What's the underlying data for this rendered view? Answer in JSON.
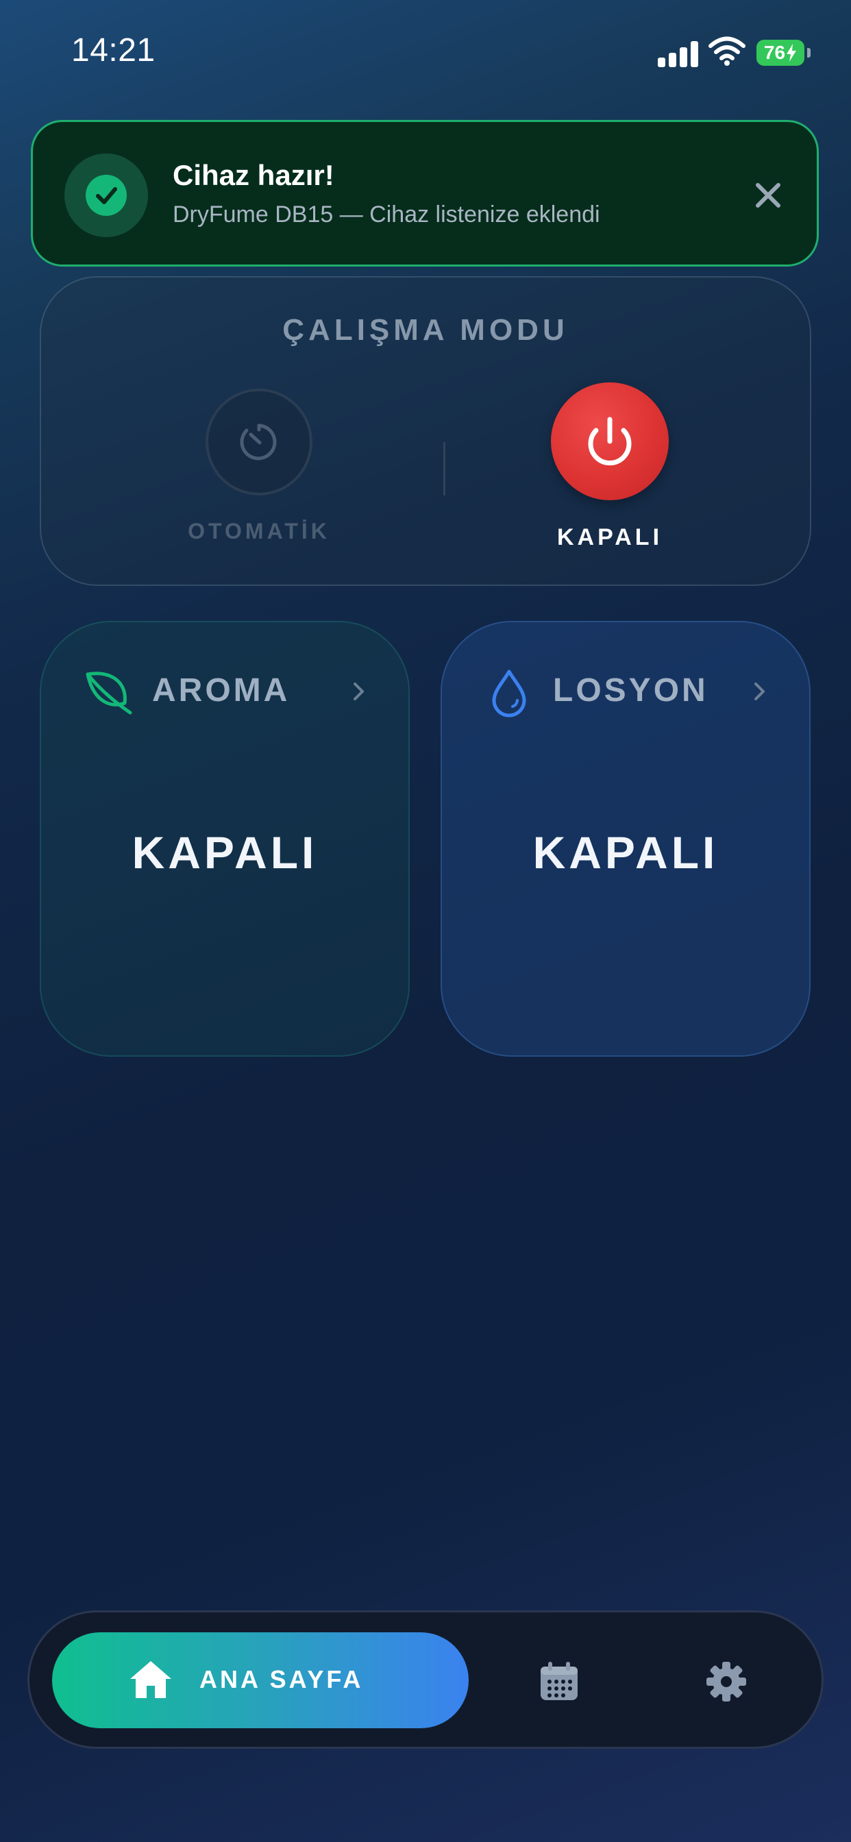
{
  "status_bar": {
    "time": "14:21",
    "battery": "76"
  },
  "toast": {
    "title": "Cihaz hazır!",
    "message": "DryFume DB15 — Cihaz listenize eklendi",
    "icon": "check-circle-icon",
    "accent_color": "#14b777"
  },
  "mode": {
    "title": "ÇALIŞMA MODU",
    "auto_label": "OTOMATİK",
    "off_label": "KAPALI",
    "selected": "off",
    "off_color": "#dd3333"
  },
  "cards": {
    "aroma": {
      "title": "AROMA",
      "state": "KAPALI",
      "icon": "leaf-icon",
      "color": "#14b777"
    },
    "losyon": {
      "title": "LOSYON",
      "state": "KAPALI",
      "icon": "water-drop-icon",
      "color": "#3b82f0"
    }
  },
  "nav": {
    "home_label": "ANA SAYFA",
    "active": "home",
    "items": [
      "home-icon",
      "calendar-icon",
      "gear-icon"
    ]
  }
}
